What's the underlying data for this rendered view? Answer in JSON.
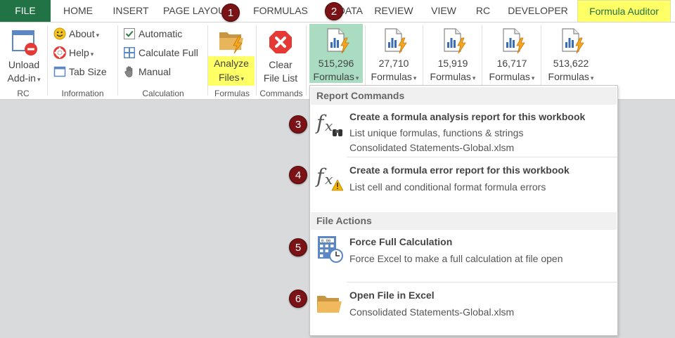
{
  "tabs": [
    {
      "label": "FILE"
    },
    {
      "label": "HOME"
    },
    {
      "label": "INSERT"
    },
    {
      "label": "PAGE LAYOUT"
    },
    {
      "label": "FORMULAS"
    },
    {
      "label": "DATA"
    },
    {
      "label": "REVIEW"
    },
    {
      "label": "VIEW"
    },
    {
      "label": "RC"
    },
    {
      "label": "DEVELOPER"
    },
    {
      "label": "Formula Auditor"
    }
  ],
  "ribbon": {
    "rc": {
      "line1": "Unload",
      "line2": "Add-in",
      "group": "RC"
    },
    "information": {
      "about": "About",
      "help": "Help",
      "tab_size": "Tab Size",
      "group": "Information"
    },
    "calculation": {
      "automatic": "Automatic",
      "calculate_full": "Calculate Full",
      "manual": "Manual",
      "group": "Calculation"
    },
    "formulas": {
      "line1": "Analyze",
      "line2": "Files",
      "group": "Formulas"
    },
    "commands": {
      "line1": "Clear",
      "line2": "File List",
      "group": "Commands"
    },
    "formula_buttons": [
      {
        "count": "515,296",
        "label": "Formulas"
      },
      {
        "count": "27,710",
        "label": "Formulas"
      },
      {
        "count": "15,919",
        "label": "Formulas"
      },
      {
        "count": "16,717",
        "label": "Formulas"
      },
      {
        "count": "513,622",
        "label": "Formulas"
      }
    ]
  },
  "menu": {
    "report_header": "Report Commands",
    "analysis": {
      "title": "Create a formula analysis report for this workbook",
      "line1": "List unique formulas, functions & strings",
      "line2": "Consolidated Statements-Global.xlsm"
    },
    "errors": {
      "title": "Create a formula error report for this workbook",
      "line1": "List cell and conditional format formula errors"
    },
    "file_header": "File Actions",
    "force": {
      "title": "Force Full Calculation",
      "line1": "Force Excel to make a full calculation at file open"
    },
    "open": {
      "title": "Open File in Excel",
      "line1": "Consolidated Statements-Global.xlsm"
    }
  },
  "badges": [
    "1",
    "2",
    "3",
    "4",
    "5",
    "6"
  ],
  "colors": {
    "file_tab": "#217346",
    "highlight": "#ffff66",
    "selected": "#a9dcc0",
    "badge": "#7b1316"
  },
  "icons": [
    "unload-addin-icon",
    "smiley-icon",
    "lifebuoy-icon",
    "tab-size-icon",
    "checkmark-icon",
    "calculator-icon",
    "hand-icon",
    "folder-lightning-icon",
    "clear-x-icon",
    "formula-sheet-icon",
    "fx-binoculars-icon",
    "fx-warning-icon",
    "calculator-clock-icon",
    "folder-icon"
  ]
}
